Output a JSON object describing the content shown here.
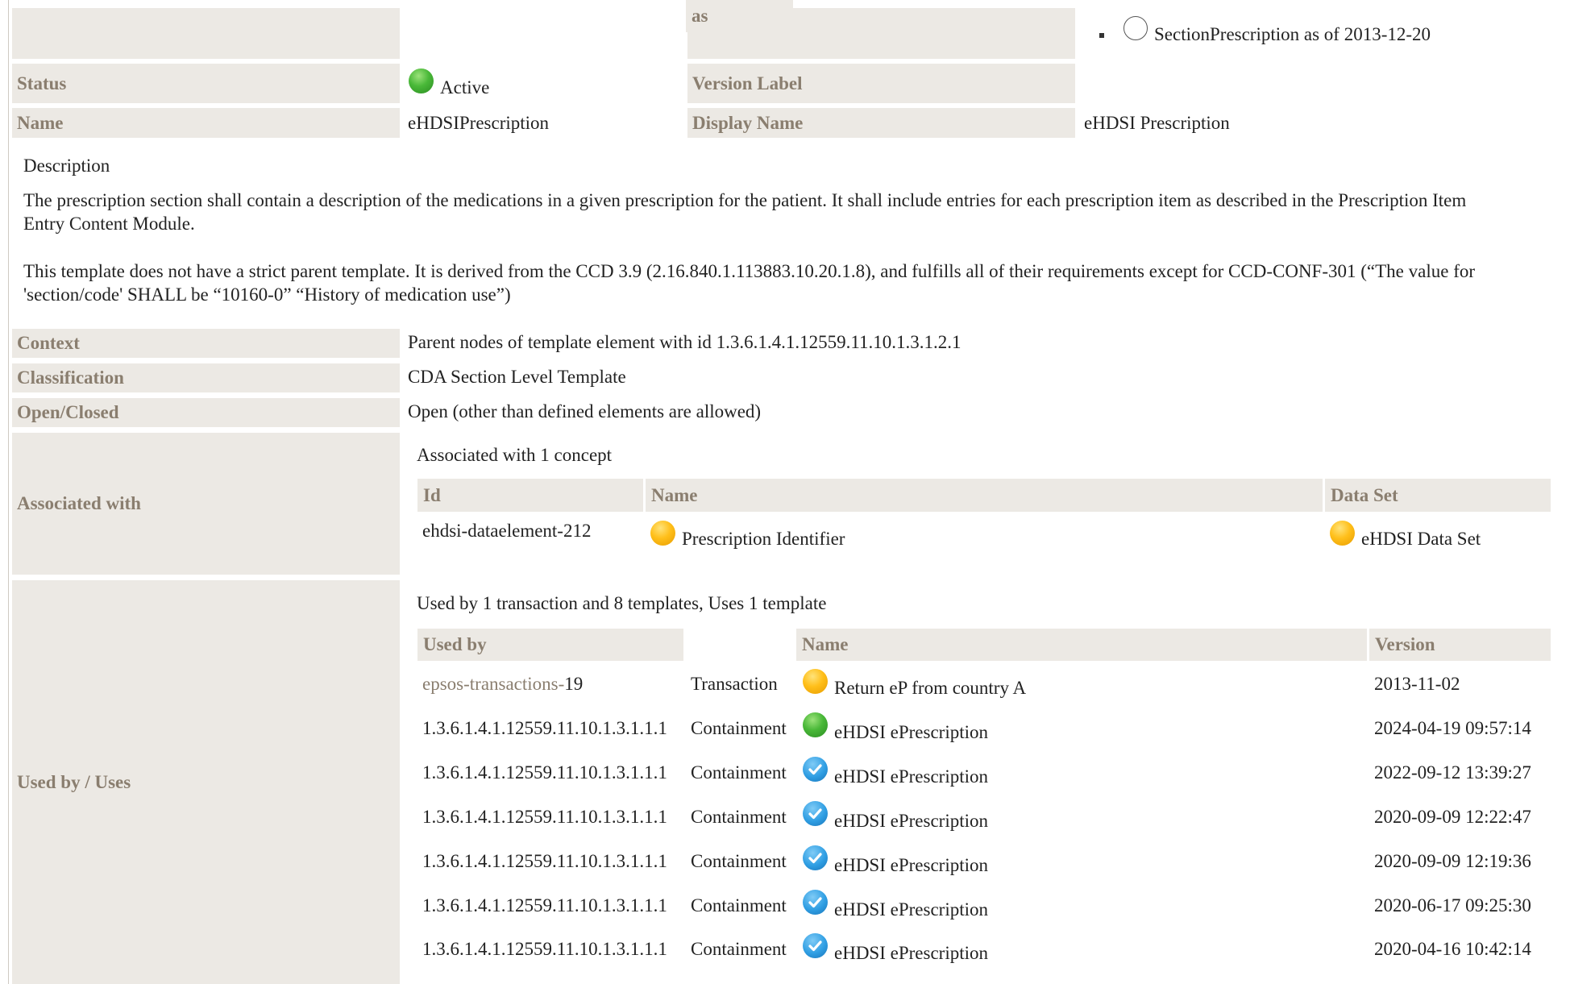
{
  "top": {
    "status_label": "Status",
    "status_value": "Active",
    "name_label": "Name",
    "name_value": "eHDSIPrescription",
    "version_label": "Version Label",
    "display_name_label": "Display Name",
    "display_name_value": "eHDSI Prescription",
    "version_list_item": "SectionPrescription as of 2013-12-20"
  },
  "description": {
    "heading": "Description",
    "para1_line1": "The prescription section shall contain a description of the medications in a given prescription for the patient. It shall include entries for each prescription item as described in the Prescription Item",
    "para1_line2": "Entry Content Module.",
    "para2_line1": "This template does not have a strict parent template. It is derived from the CCD 3.9 (2.16.840.1.113883.10.20.1.8), and fulfills all of their requirements except for CCD-CONF-301 (“The value for",
    "para2_line2": "'section/code' SHALL be “10160-0” “History of medication use”)"
  },
  "meta": {
    "context_label": "Context",
    "context_value": "Parent nodes of template element with id 1.3.6.1.4.1.12559.11.10.1.3.1.2.1",
    "classification_label": "Classification",
    "classification_value": "CDA Section Level Template",
    "open_closed_label": "Open/Closed",
    "open_closed_value": "Open (other than defined elements are allowed)"
  },
  "associated": {
    "label": "Associated with",
    "summary": "Associated with 1 concept",
    "headers": {
      "id": "Id",
      "name": "Name",
      "dataset": "Data Set"
    },
    "rows": [
      {
        "id": "ehdsi-dataelement-212",
        "name": "Prescription Identifier",
        "dataset": "eHDSI Data Set"
      }
    ]
  },
  "usedby": {
    "label": "Used by / Uses",
    "summary": "Used by 1 transaction and 8 templates, Uses 1 template",
    "headers": {
      "used_by": "Used by",
      "as": "as",
      "name": "Name",
      "version": "Version"
    },
    "rows": [
      {
        "used_by_prefix": "epsos-transactions-",
        "used_by": "19",
        "as": "Transaction",
        "status": "yellow",
        "name": "Return eP from country A",
        "version": "2013-11-02"
      },
      {
        "used_by_prefix": "",
        "used_by": "1.3.6.1.4.1.12559.11.10.1.3.1.1.1",
        "as": "Containment",
        "status": "green",
        "name": "eHDSI ePrescription",
        "version": "2024-04-19 09:57:14"
      },
      {
        "used_by_prefix": "",
        "used_by": "1.3.6.1.4.1.12559.11.10.1.3.1.1.1",
        "as": "Containment",
        "status": "blue",
        "name": "eHDSI ePrescription",
        "version": "2022-09-12 13:39:27"
      },
      {
        "used_by_prefix": "",
        "used_by": "1.3.6.1.4.1.12559.11.10.1.3.1.1.1",
        "as": "Containment",
        "status": "blue",
        "name": "eHDSI ePrescription",
        "version": "2020-09-09 12:22:47"
      },
      {
        "used_by_prefix": "",
        "used_by": "1.3.6.1.4.1.12559.11.10.1.3.1.1.1",
        "as": "Containment",
        "status": "blue",
        "name": "eHDSI ePrescription",
        "version": "2020-09-09 12:19:36"
      },
      {
        "used_by_prefix": "",
        "used_by": "1.3.6.1.4.1.12559.11.10.1.3.1.1.1",
        "as": "Containment",
        "status": "blue",
        "name": "eHDSI ePrescription",
        "version": "2020-06-17 09:25:30"
      },
      {
        "used_by_prefix": "",
        "used_by": "1.3.6.1.4.1.12559.11.10.1.3.1.1.1",
        "as": "Containment",
        "status": "blue",
        "name": "eHDSI ePrescription",
        "version": "2020-04-16 10:42:14"
      }
    ]
  },
  "colors": {
    "label_bg": "#ece9e4",
    "label_text": "#8a7e6f",
    "status_active": "#49b838",
    "status_draft": "#ffbf1a",
    "status_final": "#2f9ee3"
  }
}
